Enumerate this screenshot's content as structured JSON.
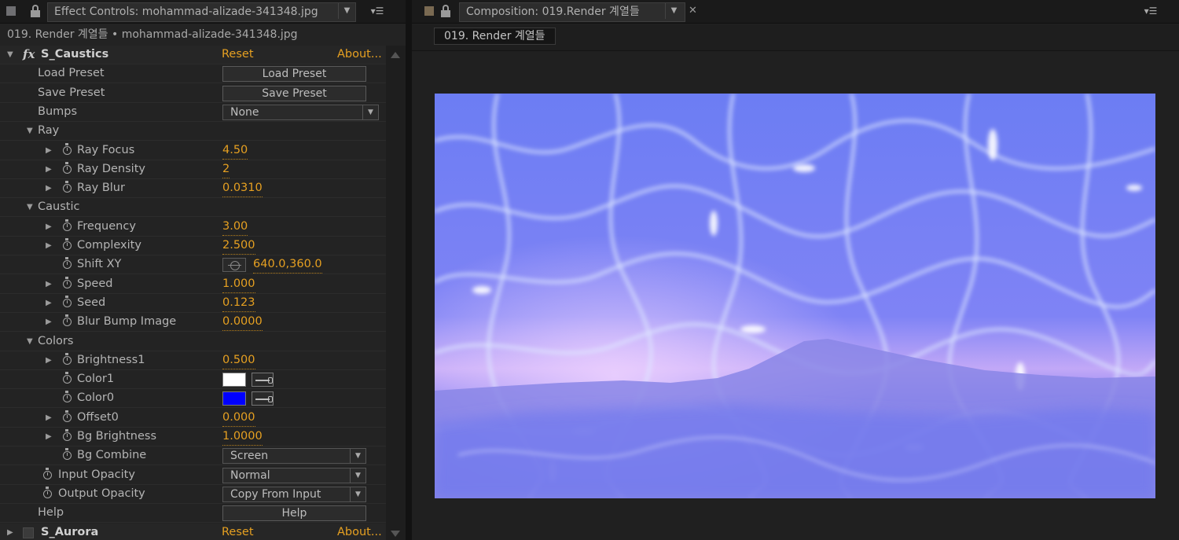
{
  "left_panel": {
    "tab_title": "Effect Controls: mohammad-alizade-341348.jpg",
    "subheader": "019. Render 계열들 • mohammad-alizade-341348.jpg",
    "effects": [
      {
        "name": "S_Caustics",
        "reset_label": "Reset",
        "about_label": "About...",
        "expanded": true,
        "params": [
          {
            "label": "Load Preset",
            "kind": "button",
            "value": "Load Preset"
          },
          {
            "label": "Save Preset",
            "kind": "button",
            "value": "Save Preset"
          },
          {
            "label": "Bumps",
            "kind": "select",
            "value": "None"
          },
          {
            "label": "Ray",
            "kind": "group"
          },
          {
            "label": "Ray Focus",
            "kind": "number",
            "value": "4.50"
          },
          {
            "label": "Ray Density",
            "kind": "number",
            "value": "2"
          },
          {
            "label": "Ray Blur",
            "kind": "number",
            "value": "0.0310"
          },
          {
            "label": "Caustic",
            "kind": "group"
          },
          {
            "label": "Frequency",
            "kind": "number",
            "value": "3.00"
          },
          {
            "label": "Complexity",
            "kind": "number",
            "value": "2.500"
          },
          {
            "label": "Shift XY",
            "kind": "point",
            "value": "640.0,360.0"
          },
          {
            "label": "Speed",
            "kind": "number",
            "value": "1.000"
          },
          {
            "label": "Seed",
            "kind": "number",
            "value": "0.123"
          },
          {
            "label": "Blur Bump Image",
            "kind": "number",
            "value": "0.0000"
          },
          {
            "label": "Colors",
            "kind": "group"
          },
          {
            "label": "Brightness1",
            "kind": "number",
            "value": "0.500"
          },
          {
            "label": "Color1",
            "kind": "color",
            "value": "#ffffff"
          },
          {
            "label": "Color0",
            "kind": "color",
            "value": "#0000ff"
          },
          {
            "label": "Offset0",
            "kind": "number",
            "value": "0.000"
          },
          {
            "label": "Bg Brightness",
            "kind": "number",
            "value": "1.0000"
          },
          {
            "label": "Bg Combine",
            "kind": "select",
            "value": "Screen"
          },
          {
            "label": "Input Opacity",
            "kind": "select",
            "value": "Normal"
          },
          {
            "label": "Output Opacity",
            "kind": "select",
            "value": "Copy From Input"
          },
          {
            "label": "Help",
            "kind": "button",
            "value": "Help"
          }
        ]
      },
      {
        "name": "S_Aurora",
        "reset_label": "Reset",
        "about_label": "About...",
        "expanded": false,
        "params": []
      }
    ]
  },
  "right_panel": {
    "tab_title": "Composition: 019.Render 계열들",
    "comp_name": "019. Render 계열들",
    "viewer_image": "underwater caustics over purple mountain landscape"
  },
  "colors": {
    "accent_value": "#e6a021",
    "panel_bg": "#232323",
    "viewer_bg": "#202020"
  }
}
